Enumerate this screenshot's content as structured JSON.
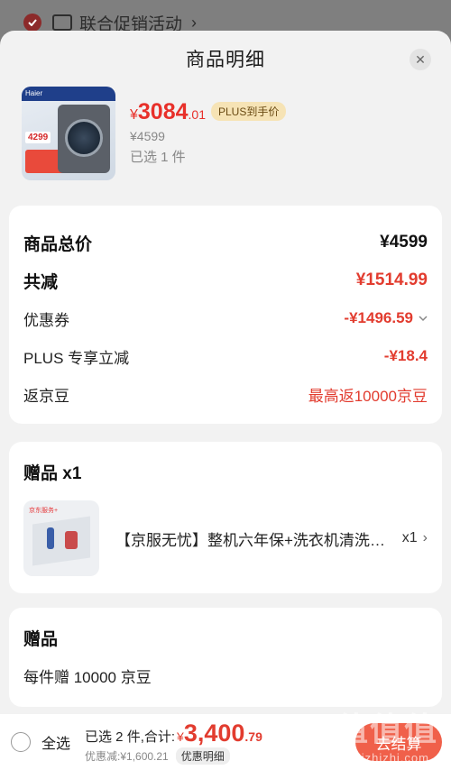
{
  "background": {
    "section_title": "联合促销活动",
    "arrow": "›"
  },
  "sheet": {
    "title": "商品明细",
    "close": "✕"
  },
  "product": {
    "thumb_brand": "Haier",
    "thumb_price": "4299",
    "price_symbol": "¥",
    "price_int": "3084",
    "price_dec": ".01",
    "plus_tag": "PLUS到手价",
    "original_price": "¥4599",
    "quantity_text": "已选 1 件"
  },
  "summary": {
    "total_label": "商品总价",
    "total_value": "¥4599",
    "reduce_label": "共减",
    "reduce_value": "¥1514.99",
    "coupon_label": "优惠券",
    "coupon_value": "-¥1496.59",
    "plus_label": "PLUS 专享立减",
    "plus_value": "-¥18.4",
    "beans_label": "返京豆",
    "beans_value": "最高返10000京豆"
  },
  "gift": {
    "title": "赠品 x1",
    "thumb_logo": "京东服务+",
    "name": "【京服无忧】整机六年保+洗衣机清洗服务",
    "qty": "x1",
    "chevron": "›"
  },
  "bonus": {
    "title": "赠品",
    "text": "每件赠 10000 京豆"
  },
  "bottom": {
    "select_all": "全选",
    "total_label": "已选 2 件,合计:",
    "total_symbol": "¥",
    "total_int": "3,400",
    "total_dec": ".79",
    "discount_text": "优惠减:¥1,600.21",
    "detail_tag": "优惠明细",
    "checkout": "去结算"
  },
  "watermark": {
    "main": "值值值",
    "sub": "zhizhizhi.com"
  },
  "colors": {
    "accent": "#e23c2f",
    "plus_tag_bg": "#f6e3b5",
    "checkout_bg": "#f0604a"
  }
}
